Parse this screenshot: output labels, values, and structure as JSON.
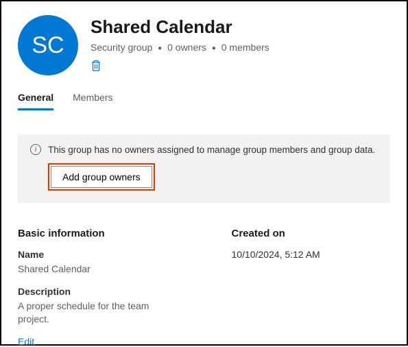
{
  "header": {
    "avatar_initials": "SC",
    "title": "Shared Calendar",
    "group_type": "Security group",
    "owners_count": "0 owners",
    "members_count": "0 members"
  },
  "tabs": {
    "general": "General",
    "members": "Members"
  },
  "banner": {
    "message": "This group has no owners assigned to manage group members and group data.",
    "button_label": "Add group owners"
  },
  "basic_info": {
    "section_title": "Basic information",
    "name_label": "Name",
    "name_value": "Shared Calendar",
    "description_label": "Description",
    "description_value": "A proper schedule for the team project.",
    "edit_label": "Edit"
  },
  "created": {
    "section_title": "Created on",
    "value": "10/10/2024, 5:12 AM"
  }
}
